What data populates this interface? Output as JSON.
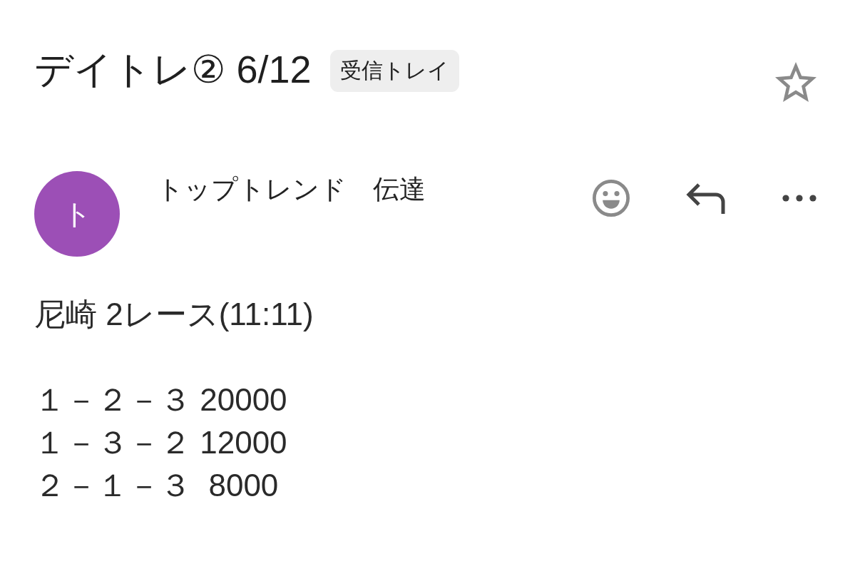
{
  "header": {
    "subject": "デイトレ② 6/12",
    "label": "受信トレイ",
    "starred": false
  },
  "sender": {
    "avatar_letter": "ト",
    "name": "トップトレンド　伝達"
  },
  "body": {
    "paragraphs": [
      [
        "尼崎 2レース(11:11)"
      ],
      [
        "１－２－３ 20000",
        "１－３－２ 12000",
        "２－１－３  8000"
      ]
    ]
  }
}
